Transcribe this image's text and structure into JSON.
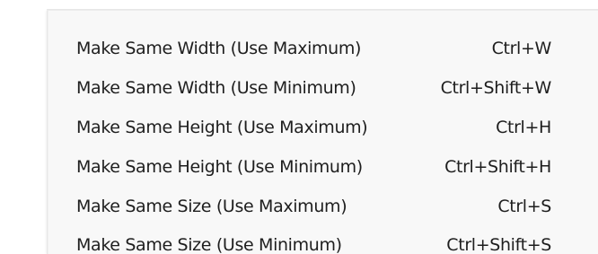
{
  "menu": {
    "items": [
      {
        "label": "Make Same Width (Use Maximum)",
        "shortcut": "Ctrl+W"
      },
      {
        "label": "Make Same Width (Use Minimum)",
        "shortcut": "Ctrl+Shift+W"
      },
      {
        "label": "Make Same Height (Use Maximum)",
        "shortcut": "Ctrl+H"
      },
      {
        "label": "Make Same Height (Use Minimum)",
        "shortcut": "Ctrl+Shift+H"
      },
      {
        "label": "Make Same Size (Use Maximum)",
        "shortcut": "Ctrl+S"
      },
      {
        "label": "Make Same Size (Use Minimum)",
        "shortcut": "Ctrl+Shift+S"
      }
    ]
  }
}
